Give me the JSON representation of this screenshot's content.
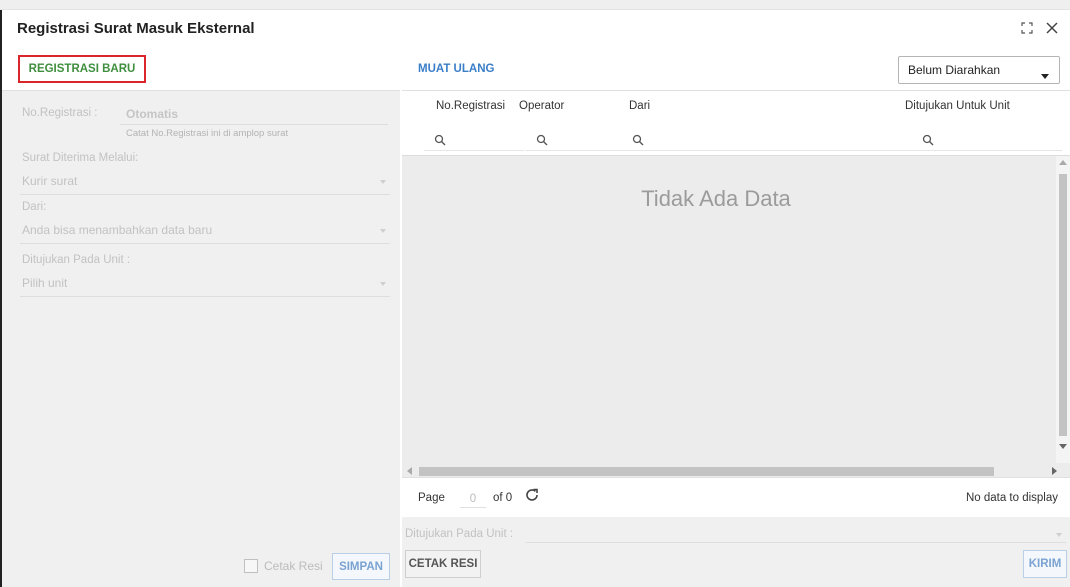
{
  "window": {
    "title": "Registrasi Surat Masuk Eksternal"
  },
  "toolbar": {
    "register_new_label": "REGISTRASI BARU",
    "reload_label": "MUAT ULANG",
    "status_filter_value": "Belum Diarahkan"
  },
  "form": {
    "reg_number_label": "No.Registrasi :",
    "reg_number_value": "Otomatis",
    "reg_number_hint": "Catat No.Registrasi ini di amplop surat",
    "received_via_label": "Surat Diterima Melalui:",
    "received_via_value": "Kurir surat",
    "from_label": "Dari:",
    "from_placeholder": "Anda bisa menambahkan data baru",
    "unit_label": "Ditujukan Pada Unit :",
    "unit_placeholder": "Pilih unit",
    "print_receipt_label": "Cetak Resi",
    "save_label": "SIMPAN"
  },
  "grid": {
    "columns": [
      "No.Registrasi",
      "Operator",
      "Dari",
      "Ditujukan Untuk Unit"
    ],
    "empty_text": "Tidak Ada Data",
    "pager": {
      "page_label": "Page",
      "page_value": "0",
      "of_label": "of 0",
      "status_text": "No data to display"
    }
  },
  "bottom": {
    "unit_label": "Ditujukan Pada Unit :",
    "print_receipt_label": "CETAK RESI",
    "send_label": "KIRIM"
  },
  "colors": {
    "accent_red": "#d9262b",
    "accent_green": "#3f8f3f",
    "accent_blue": "#3a7ec8"
  }
}
